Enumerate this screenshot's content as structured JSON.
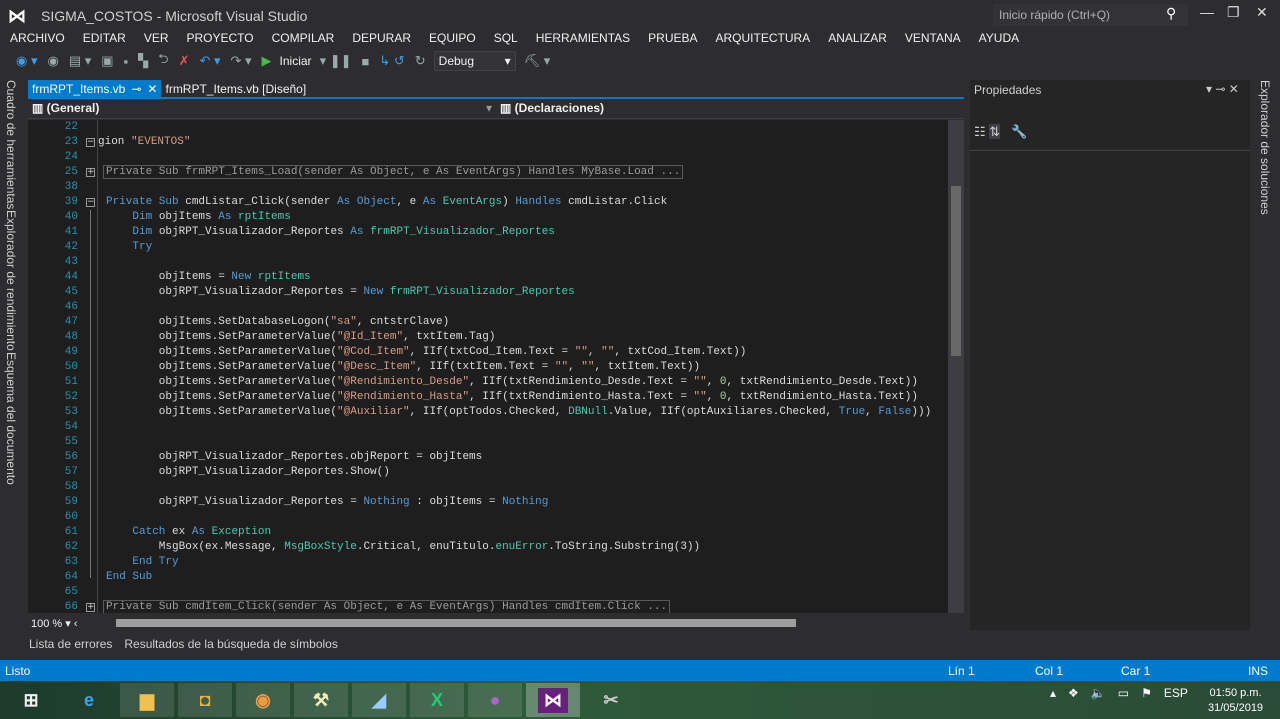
{
  "window": {
    "title": "SIGMA_COSTOS - Microsoft Visual Studio",
    "quick_launch_placeholder": "Inicio rápido (Ctrl+Q)"
  },
  "menu": [
    "ARCHIVO",
    "EDITAR",
    "VER",
    "PROYECTO",
    "COMPILAR",
    "DEPURAR",
    "EQUIPO",
    "SQL",
    "HERRAMIENTAS",
    "PRUEBA",
    "ARQUITECTURA",
    "ANALIZAR",
    "VENTANA",
    "AYUDA"
  ],
  "toolbar": {
    "start_label": "Iniciar",
    "config": "Debug"
  },
  "left_tabs": [
    "Cuadro de herramientas",
    "Explorador de rendimiento",
    "Esquema del documento"
  ],
  "right_tabs": [
    "Explorador de soluciones"
  ],
  "doc_tabs": [
    {
      "label": "frmRPT_Items.vb",
      "active": true
    },
    {
      "label": "frmRPT_Items.vb [Diseño]",
      "active": false
    }
  ],
  "nav": {
    "left": "(General)",
    "right": "(Declaraciones)"
  },
  "colors": {
    "accent": "#007acc",
    "keyword": "#569cd6",
    "type": "#4ec9b0",
    "string": "#d69d85",
    "line_number": "#2b91af"
  },
  "code": [
    {
      "n": "22",
      "tokens": []
    },
    {
      "n": "23",
      "fold": "minus",
      "tokens": [
        [
          "p",
          "gion "
        ],
        [
          "s",
          "\"EVENTOS\""
        ]
      ]
    },
    {
      "n": "24",
      "tokens": []
    },
    {
      "n": "25",
      "fold": "plus",
      "collapsed": "Private Sub frmRPT_Items_Load(sender As Object, e As EventArgs) Handles MyBase.Load ..."
    },
    {
      "n": "38",
      "tokens": []
    },
    {
      "n": "39",
      "fold": "minus",
      "tokens": [
        [
          "k",
          "Private Sub"
        ],
        [
          "p",
          " cmdListar_Click(sender "
        ],
        [
          "k",
          "As"
        ],
        [
          "p",
          " "
        ],
        [
          "k",
          "Object"
        ],
        [
          "p",
          ", e "
        ],
        [
          "k",
          "As"
        ],
        [
          "p",
          " "
        ],
        [
          "t",
          "EventArgs"
        ],
        [
          "p",
          ") "
        ],
        [
          "k",
          "Handles"
        ],
        [
          "p",
          " cmdListar.Click"
        ]
      ]
    },
    {
      "n": "40",
      "tokens": [
        [
          "p",
          "    "
        ],
        [
          "k",
          "Dim"
        ],
        [
          "p",
          " objItems "
        ],
        [
          "k",
          "As"
        ],
        [
          "p",
          " "
        ],
        [
          "t",
          "rptItems"
        ]
      ]
    },
    {
      "n": "41",
      "tokens": [
        [
          "p",
          "    "
        ],
        [
          "k",
          "Dim"
        ],
        [
          "p",
          " objRPT_Visualizador_Reportes "
        ],
        [
          "k",
          "As"
        ],
        [
          "p",
          " "
        ],
        [
          "t",
          "frmRPT_Visualizador_Reportes"
        ]
      ]
    },
    {
      "n": "42",
      "tokens": [
        [
          "p",
          "    "
        ],
        [
          "k",
          "Try"
        ]
      ]
    },
    {
      "n": "43",
      "tokens": []
    },
    {
      "n": "44",
      "tokens": [
        [
          "p",
          "        objItems = "
        ],
        [
          "k",
          "New"
        ],
        [
          "p",
          " "
        ],
        [
          "t",
          "rptItems"
        ]
      ]
    },
    {
      "n": "45",
      "tokens": [
        [
          "p",
          "        objRPT_Visualizador_Reportes = "
        ],
        [
          "k",
          "New"
        ],
        [
          "p",
          " "
        ],
        [
          "t",
          "frmRPT_Visualizador_Reportes"
        ]
      ]
    },
    {
      "n": "46",
      "tokens": []
    },
    {
      "n": "47",
      "tokens": [
        [
          "p",
          "        objItems.SetDatabaseLogon("
        ],
        [
          "s",
          "\"sa\""
        ],
        [
          "p",
          ", cntstrClave)"
        ]
      ]
    },
    {
      "n": "48",
      "tokens": [
        [
          "p",
          "        objItems.SetParameterValue("
        ],
        [
          "s",
          "\"@Id_Item\""
        ],
        [
          "p",
          ", txtItem.Tag)"
        ]
      ]
    },
    {
      "n": "49",
      "tokens": [
        [
          "p",
          "        objItems.SetParameterValue("
        ],
        [
          "s",
          "\"@Cod_Item\""
        ],
        [
          "p",
          ", IIf(txtCod_Item.Text = "
        ],
        [
          "s",
          "\"\""
        ],
        [
          "p",
          ", "
        ],
        [
          "s",
          "\"\""
        ],
        [
          "p",
          ", txtCod_Item.Text))"
        ]
      ]
    },
    {
      "n": "50",
      "tokens": [
        [
          "p",
          "        objItems.SetParameterValue("
        ],
        [
          "s",
          "\"@Desc_Item\""
        ],
        [
          "p",
          ", IIf(txtItem.Text = "
        ],
        [
          "s",
          "\"\""
        ],
        [
          "p",
          ", "
        ],
        [
          "s",
          "\"\""
        ],
        [
          "p",
          ", txtItem.Text))"
        ]
      ]
    },
    {
      "n": "51",
      "tokens": [
        [
          "p",
          "        objItems.SetParameterValue("
        ],
        [
          "s",
          "\"@Rendimiento_Desde\""
        ],
        [
          "p",
          ", IIf(txtRendimiento_Desde.Text = "
        ],
        [
          "s",
          "\"\""
        ],
        [
          "p",
          ", "
        ],
        [
          "n",
          "0"
        ],
        [
          "p",
          ", txtRendimiento_Desde.Text))"
        ]
      ]
    },
    {
      "n": "52",
      "tokens": [
        [
          "p",
          "        objItems.SetParameterValue("
        ],
        [
          "s",
          "\"@Rendimiento_Hasta\""
        ],
        [
          "p",
          ", IIf(txtRendimiento_Hasta.Text = "
        ],
        [
          "s",
          "\"\""
        ],
        [
          "p",
          ", "
        ],
        [
          "n",
          "0"
        ],
        [
          "p",
          ", txtRendimiento_Hasta.Text))"
        ]
      ]
    },
    {
      "n": "53",
      "tokens": [
        [
          "p",
          "        objItems.SetParameterValue("
        ],
        [
          "s",
          "\"@Auxiliar\""
        ],
        [
          "p",
          ", IIf(optTodos.Checked, "
        ],
        [
          "t",
          "DBNull"
        ],
        [
          "p",
          ".Value, IIf(optAuxiliares.Checked, "
        ],
        [
          "k",
          "True"
        ],
        [
          "p",
          ", "
        ],
        [
          "k",
          "False"
        ],
        [
          "p",
          ")))"
        ]
      ]
    },
    {
      "n": "54",
      "tokens": []
    },
    {
      "n": "55",
      "tokens": []
    },
    {
      "n": "56",
      "tokens": [
        [
          "p",
          "        objRPT_Visualizador_Reportes.objReport = objItems"
        ]
      ]
    },
    {
      "n": "57",
      "tokens": [
        [
          "p",
          "        objRPT_Visualizador_Reportes.Show()"
        ]
      ]
    },
    {
      "n": "58",
      "tokens": []
    },
    {
      "n": "59",
      "tokens": [
        [
          "p",
          "        objRPT_Visualizador_Reportes = "
        ],
        [
          "k",
          "Nothing"
        ],
        [
          "p",
          " : objItems = "
        ],
        [
          "k",
          "Nothing"
        ]
      ]
    },
    {
      "n": "60",
      "tokens": []
    },
    {
      "n": "61",
      "tokens": [
        [
          "p",
          "    "
        ],
        [
          "k",
          "Catch"
        ],
        [
          "p",
          " ex "
        ],
        [
          "k",
          "As"
        ],
        [
          "p",
          " "
        ],
        [
          "t",
          "Exception"
        ]
      ]
    },
    {
      "n": "62",
      "tokens": [
        [
          "p",
          "        MsgBox(ex.Message, "
        ],
        [
          "t",
          "MsgBoxStyle"
        ],
        [
          "p",
          ".Critical, enuTitulo."
        ],
        [
          "t",
          "enuError"
        ],
        [
          "p",
          ".ToString.Substring(3))"
        ]
      ]
    },
    {
      "n": "63",
      "tokens": [
        [
          "p",
          "    "
        ],
        [
          "k",
          "End Try"
        ]
      ]
    },
    {
      "n": "64",
      "tokens": [
        [
          "k",
          "End Sub"
        ]
      ]
    },
    {
      "n": "65",
      "tokens": []
    },
    {
      "n": "66",
      "fold": "plus",
      "collapsed": "Private Sub cmdItem_Click(sender As Object, e As EventArgs) Handles cmdItem.Click ..."
    }
  ],
  "editor": {
    "zoom": "100 %"
  },
  "properties": {
    "title": "Propiedades"
  },
  "bottom_tabs": [
    "Lista de errores",
    "Resultados de la búsqueda de símbolos"
  ],
  "status": {
    "text": "Listo",
    "line": "Lín 1",
    "col": "Col 1",
    "char": "Car 1",
    "mode": "INS"
  },
  "taskbar": {
    "apps": [
      "start",
      "internet-explorer",
      "file-explorer",
      "app",
      "chrome",
      "tools",
      "app",
      "excel",
      "app",
      "visual-studio",
      "snipping-tool"
    ],
    "language": "ESP",
    "time": "01:50 p.m.",
    "date": "31/05/2019"
  }
}
